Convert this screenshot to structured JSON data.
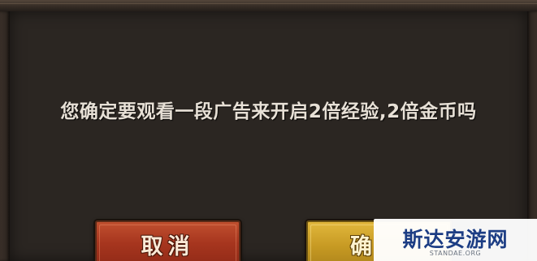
{
  "dialog": {
    "message": "您确定要观看一段广告来开启2倍经验,2倍金币吗",
    "cancel_label": "取消",
    "confirm_label": "确"
  },
  "watermark": {
    "title": "斯达安游网",
    "subtitle": "STANDAE.ORG"
  },
  "colors": {
    "background": "#2b2622",
    "message_text": "#e7e0d6",
    "cancel_button": "#a6351e",
    "confirm_button": "#c79a23",
    "watermark_text": "#1c3d84"
  }
}
